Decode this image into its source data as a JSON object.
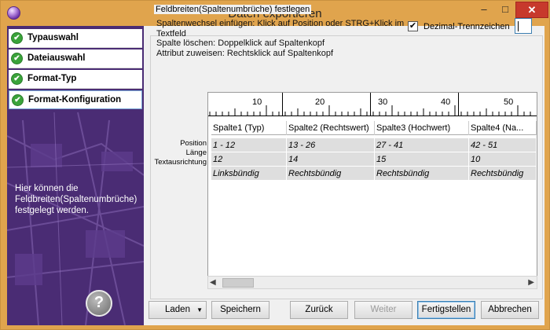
{
  "window": {
    "title": "Daten exportieren",
    "min_glyph": "–",
    "max_glyph": "□",
    "close_glyph": "✕"
  },
  "steps": [
    {
      "label": "Typauswahl"
    },
    {
      "label": "Dateiauswahl"
    },
    {
      "label": "Format-Typ"
    },
    {
      "label": "Format-Konfiguration"
    }
  ],
  "nav": {
    "check_glyph": "✔",
    "description": "Hier können die Feldbreiten(Spaltenumbrüche) festgelegt werden.",
    "help_glyph": "?"
  },
  "group": {
    "legend": "Feldbreiten(Spaltenumbrüche) festlegen",
    "instructions": [
      "Spaltenwechsel einfügen: Klick auf Position oder STRG+Klick im Textfeld",
      "Spalte löschen: Doppelklick auf Spaltenkopf",
      "Attribut zuweisen: Rechtsklick auf Spaltenkopf"
    ],
    "decimal_checkbox_label": "Dezimal-Trennzeichen",
    "decimal_checked": true,
    "check_glyph": "✔",
    "decimal_value": ""
  },
  "row_labels": [
    "Position",
    "Länge",
    "Textausrichtung"
  ],
  "ruler": {
    "ticks": [
      "10",
      "20",
      "30",
      "40",
      "50"
    ]
  },
  "columns": [
    {
      "header": "Spalte1 (Typ)",
      "position": "1 - 12",
      "length": "12",
      "alignment": "Linksbündig"
    },
    {
      "header": "Spalte2 (Rechtswert)",
      "position": "13 - 26",
      "length": "14",
      "alignment": "Rechtsbündig"
    },
    {
      "header": "Spalte3 (Hochwert)",
      "position": "27 - 41",
      "length": "15",
      "alignment": "Rechtsbündig"
    },
    {
      "header": "Spalte4 (Na...",
      "position": "42 - 51",
      "length": "10",
      "alignment": "Rechtsbündig"
    }
  ],
  "scroll": {
    "left_glyph": "◀",
    "right_glyph": "▶"
  },
  "buttons": {
    "load": "Laden",
    "load_arrow": "▼",
    "save": "Speichern",
    "back": "Zurück",
    "next": "Weiter",
    "finish": "Fertigstellen",
    "cancel": "Abbrechen"
  }
}
